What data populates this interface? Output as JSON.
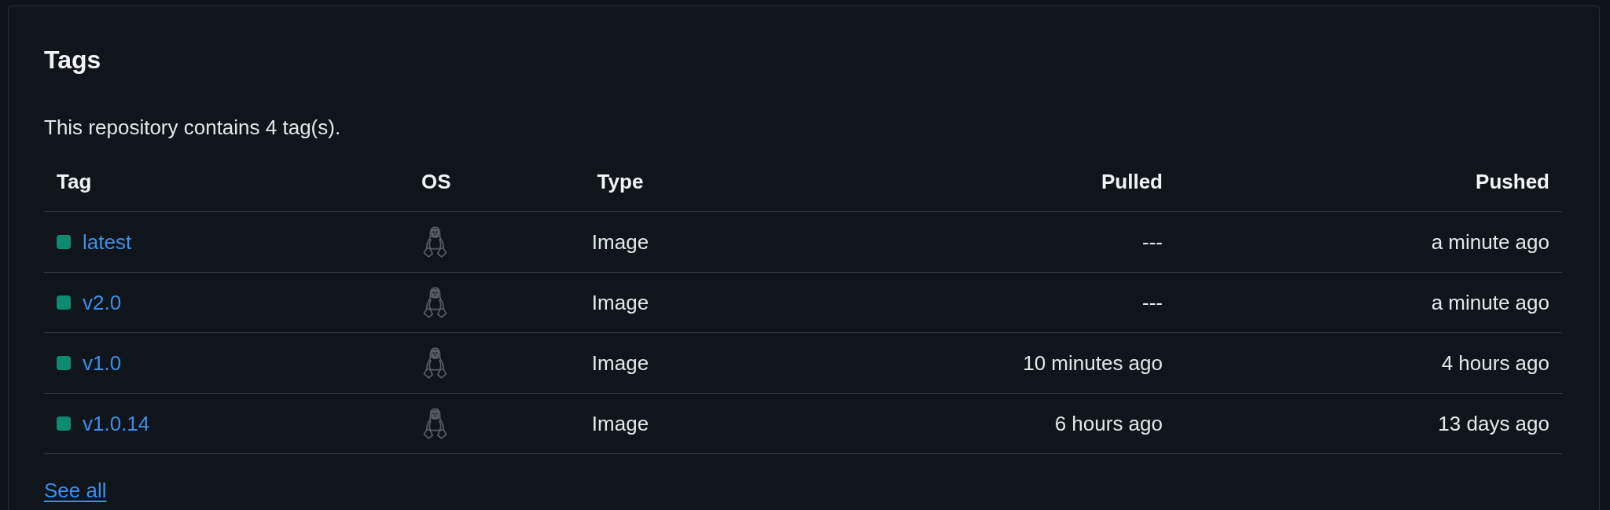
{
  "section": {
    "title": "Tags",
    "summary": "This repository contains 4 tag(s)."
  },
  "table": {
    "columns": [
      "Tag",
      "OS",
      "Type",
      "Pulled",
      "Pushed"
    ],
    "rows": [
      {
        "tag": "latest",
        "color": "#0f8a6f",
        "type": "Image",
        "pulled": "---",
        "pushed": "a minute ago"
      },
      {
        "tag": "v2.0",
        "color": "#0f8a6f",
        "type": "Image",
        "pulled": "---",
        "pushed": "a minute ago"
      },
      {
        "tag": "v1.0",
        "color": "#0f8a6f",
        "type": "Image",
        "pulled": "10 minutes ago",
        "pushed": "4 hours ago"
      },
      {
        "tag": "v1.0.14",
        "color": "#0f8a6f",
        "type": "Image",
        "pulled": "6 hours ago",
        "pushed": "13 days ago"
      }
    ]
  },
  "see_all": "See all"
}
